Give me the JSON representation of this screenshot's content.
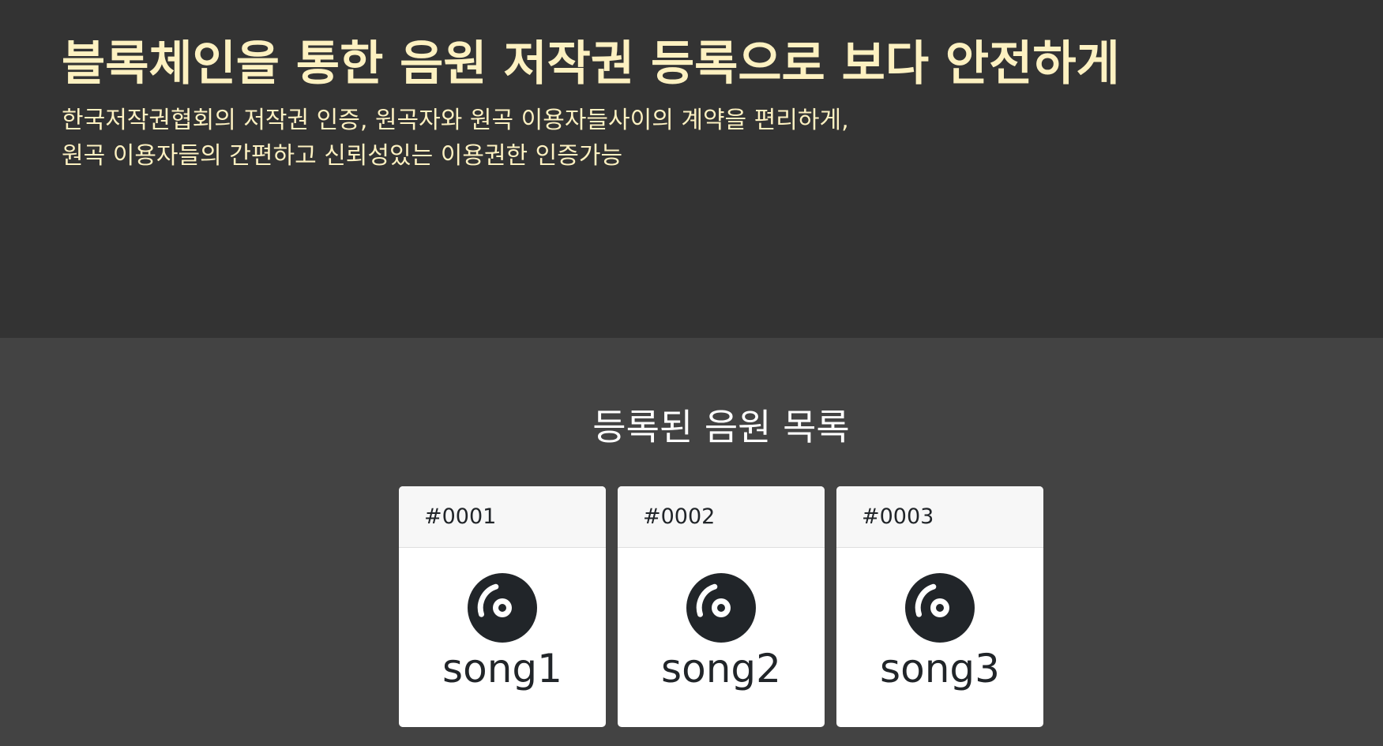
{
  "hero": {
    "title": "블록체인을 통한 음원 저작권 등록으로 보다 안전하게",
    "subtitle_line1": "한국저작권협회의 저작권 인증, 원곡자와 원곡 이용자들사이의 계약을 편리하게,",
    "subtitle_line2": "원곡 이용자들의 간편하고 신뢰성있는 이용권한 인증가능"
  },
  "songs_section": {
    "title": "등록된 음원 목록",
    "songs": [
      {
        "id": "#0001",
        "title": "song1",
        "icon": "disc-icon"
      },
      {
        "id": "#0002",
        "title": "song2",
        "icon": "disc-icon"
      },
      {
        "id": "#0003",
        "title": "song3",
        "icon": "disc-icon"
      }
    ]
  },
  "colors": {
    "hero_background": "#333333",
    "section_background": "#434343",
    "accent_text": "#fdf1c1",
    "card_header_background": "#f7f7f7",
    "icon_color": "#212529"
  }
}
